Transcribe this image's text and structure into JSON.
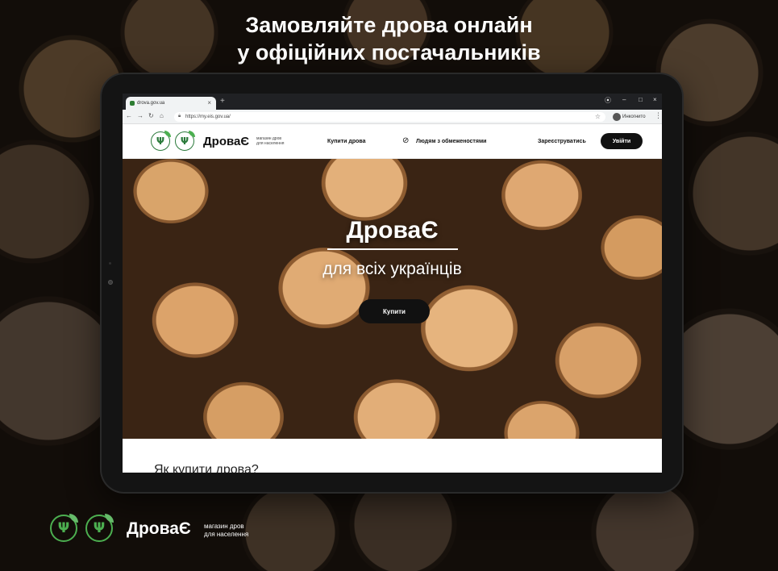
{
  "headline": {
    "line1": "Замовляйте дрова онлайн",
    "line2": "у офіційних постачальників"
  },
  "browser": {
    "tab_title": "drova.gov.ua",
    "tab_close": "×",
    "new_tab": "+",
    "url": "https://my.eis.gov.ua/",
    "profile_label": "Инкогнито",
    "controls": {
      "minimize": "–",
      "maximize": "□",
      "close": "×"
    }
  },
  "site": {
    "brand": "ДроваЄ",
    "brand_sub_line1": "магазин дров",
    "brand_sub_line2": "для населення",
    "nav": {
      "buy": "Купити дрова",
      "accessibility": "Людям з обмеженостями",
      "register": "Зареєструватись",
      "login": "Увійти"
    },
    "hero": {
      "title": "ДроваЄ",
      "subtitle": "для всіх українців",
      "button": "Купити"
    },
    "section_title": "Як купити дрова?"
  },
  "footer": {
    "brand": "ДроваЄ",
    "sub_line1": "магазин дров",
    "sub_line2": "для населення"
  },
  "icons": {
    "emblem": "trident-icon",
    "leaf": "leaf-icon",
    "accessibility": "eye-slash-icon",
    "lock": "lock-icon",
    "star": "star-icon"
  },
  "colors": {
    "accent_green": "#4caf50",
    "button_dark": "#111111",
    "text_light": "#ffffff"
  }
}
